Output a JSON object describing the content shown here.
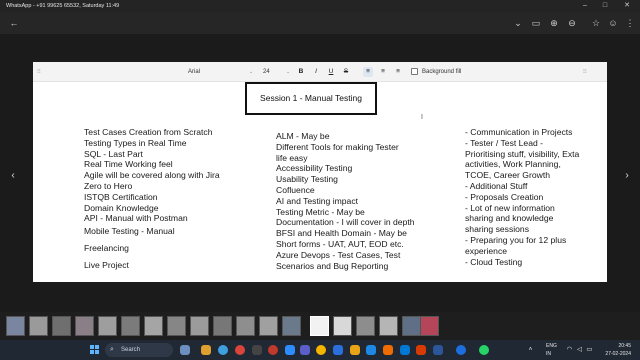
{
  "window": {
    "title": "WhatsApp - +91 99625 65532, Saturday 11:49"
  },
  "toolbar": {
    "back_icon": "back-arrow-icon",
    "icons": [
      "chevron-down-icon",
      "screen-icon",
      "zoom-in-icon",
      "zoom-out-icon",
      "fit-icon",
      "star-icon",
      "emoji-icon",
      "more-icon"
    ]
  },
  "doc_toolbar": {
    "font": "Arial",
    "size": "24",
    "bold": "B",
    "italic": "I",
    "underline": "U",
    "strike": "S",
    "background_fill": "Background fill"
  },
  "slide": {
    "title": "Session 1 - Manual Testing",
    "col1": [
      "Test Cases Creation from Scratch",
      "Testing Types in Real Time",
      "SQL - Last Part",
      "Real Time Working feel",
      "Agile will be covered along with Jira",
      "Zero to Hero",
      "ISTQB Certification",
      "Domain Knowledge",
      "API - Manual with Postman",
      "Mobile Testing - Manual",
      "Freelancing",
      "Live Project"
    ],
    "col2": [
      "ALM - May be",
      "Different Tools for making Tester",
      "life easy",
      "Accessibility Testing",
      "Usability Testing",
      "Cofluence",
      "AI and Testing impact",
      "Testing Metric - May be",
      "Documentation - I will cover in depth",
      "BFSI and Health Domain - May be",
      "Short forms - UAT, AUT, EOD etc.",
      "Azure Devops - Test Cases, Test",
      "Scenarios and Bug Reporting"
    ],
    "col3": [
      "- Communication in Projects",
      "- Tester / Test Lead -",
      "Prioritising stuff, visibility, Exta",
      "activities, Work Planning,",
      "TCOE, Career Growth",
      "- Additional Stuff",
      "- Proposals Creation",
      "- Lot of new information",
      "sharing and knowledge",
      "sharing sessions",
      "- Preparing you for 12 plus",
      "experience",
      "- Cloud Testing"
    ]
  },
  "taskbar": {
    "search_placeholder": "Search",
    "lang": "ENG",
    "region": "IN",
    "time": "20:45",
    "date": "27-02-2024"
  }
}
